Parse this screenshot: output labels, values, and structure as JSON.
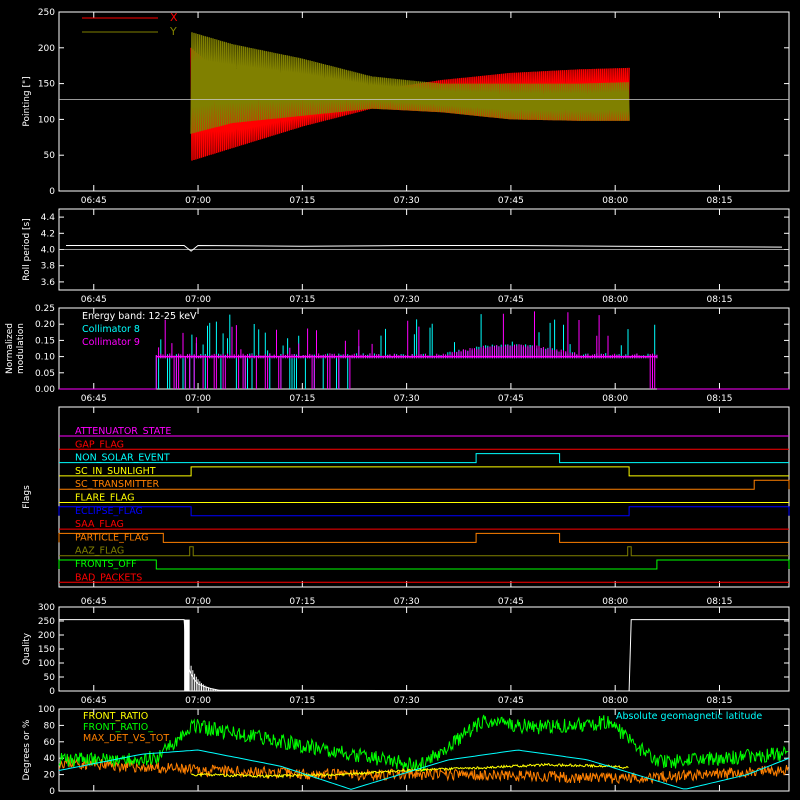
{
  "colors": {
    "background": "#000000",
    "axis": "#ffffff",
    "red": "#ff0000",
    "olive": "#808000",
    "cyan": "#00ffff",
    "magenta": "#ff00ff",
    "green": "#00ff00",
    "yellow": "#ffff00",
    "orange": "#ff8000",
    "blue": "#0000ff"
  },
  "time_ticks": [
    "06:45",
    "07:00",
    "07:15",
    "07:30",
    "07:45",
    "08:00",
    "08:15"
  ],
  "chart_data": [
    {
      "id": "pointing",
      "type": "line",
      "ylabel": "Pointing [\"]",
      "ylim": [
        0,
        250
      ],
      "yticks": [
        0,
        50,
        100,
        150,
        200,
        250
      ],
      "xlim": [
        "06:40",
        "08:25"
      ],
      "legend": [
        {
          "name": "X",
          "color": "#ff0000"
        },
        {
          "name": "Y",
          "color": "#808000"
        }
      ],
      "reference_line": 128,
      "series": [
        {
          "name": "X",
          "color": "#ff0000",
          "x": [
            "06:59",
            "07:05",
            "07:15",
            "07:25",
            "07:35",
            "07:45",
            "07:55",
            "08:02"
          ],
          "y_min": [
            42,
            60,
            90,
            115,
            110,
            100,
            98,
            98
          ],
          "y_max": [
            200,
            150,
            140,
            140,
            155,
            165,
            170,
            172
          ]
        },
        {
          "name": "Y",
          "color": "#808000",
          "x": [
            "06:59",
            "07:05",
            "07:15",
            "07:25",
            "07:35",
            "07:45",
            "07:55",
            "08:02"
          ],
          "y_min": [
            80,
            95,
            105,
            115,
            110,
            100,
            98,
            98
          ],
          "y_max": [
            222,
            205,
            185,
            160,
            150,
            150,
            150,
            152
          ]
        }
      ]
    },
    {
      "id": "roll",
      "type": "line",
      "ylabel": "Roll period [s]",
      "ylim": [
        3.5,
        4.5
      ],
      "yticks": [
        "3.6",
        "3.8",
        "4.0",
        "4.2",
        "4.4"
      ],
      "xlim": [
        "06:40",
        "08:25"
      ],
      "reference_line": 4.0,
      "series": [
        {
          "name": "Roll period",
          "color": "#ffffff",
          "x": [
            "06:41",
            "06:58",
            "06:59",
            "07:00",
            "07:15",
            "07:30",
            "07:45",
            "08:00",
            "08:24"
          ],
          "y": [
            4.05,
            4.05,
            3.98,
            4.05,
            4.04,
            4.05,
            4.05,
            4.04,
            4.03
          ]
        }
      ]
    },
    {
      "id": "modulation",
      "type": "line",
      "ylabel": "Normalized modulation",
      "ylim": [
        0,
        0.25
      ],
      "yticks": [
        "0.00",
        "0.05",
        "0.10",
        "0.15",
        "0.20",
        "0.25"
      ],
      "xlim": [
        "06:40",
        "08:25"
      ],
      "annotation": "Energy band: 12-25 keV",
      "legend": [
        {
          "name": "Collimator 8",
          "color": "#00ffff"
        },
        {
          "name": "Collimator 9",
          "color": "#ff00ff"
        }
      ],
      "active_range": [
        "06:54",
        "08:06"
      ],
      "baseline": 0.1,
      "series": [
        {
          "name": "Collimator 8",
          "color": "#00ffff"
        },
        {
          "name": "Collimator 9",
          "color": "#ff00ff"
        }
      ]
    },
    {
      "id": "flags",
      "type": "line",
      "ylabel": "Flags",
      "xlim": [
        "06:40",
        "08:25"
      ],
      "series": [
        {
          "name": "ATTENUATOR_STATE",
          "color": "#ff00ff",
          "high": []
        },
        {
          "name": "GAP_FLAG",
          "color": "#ff0000",
          "high": []
        },
        {
          "name": "NON_SOLAR_EVENT",
          "color": "#00ffff",
          "high": [
            [
              "07:40",
              "07:52"
            ]
          ]
        },
        {
          "name": "SC_IN_SUNLIGHT",
          "color": "#ffff00",
          "high": [
            [
              "06:59",
              "08:02"
            ]
          ]
        },
        {
          "name": "SC_TRANSMITTER",
          "color": "#ff8000",
          "high": [
            [
              "08:20",
              "08:25"
            ]
          ]
        },
        {
          "name": "FLARE_FLAG",
          "color": "#ffff00",
          "high": []
        },
        {
          "name": "ECLIPSE_FLAG",
          "color": "#0000ff",
          "high": [
            [
              "06:40",
              "06:59"
            ],
            [
              "08:02",
              "08:25"
            ]
          ]
        },
        {
          "name": "SAA_FLAG",
          "color": "#ff0000",
          "high": []
        },
        {
          "name": "PARTICLE_FLAG",
          "color": "#ff8000",
          "high": [
            [
              "06:40",
              "06:55"
            ],
            [
              "07:40",
              "07:52"
            ]
          ]
        },
        {
          "name": "AAZ_FLAG",
          "color": "#808000",
          "high": [
            [
              "06:58.8",
              "06:59.3"
            ],
            [
              "08:01.8",
              "08:02.3"
            ]
          ]
        },
        {
          "name": "FRONTS_OFF",
          "color": "#00ff00",
          "high": [
            [
              "06:40",
              "06:54"
            ],
            [
              "08:06",
              "08:25"
            ]
          ]
        },
        {
          "name": "BAD_PACKETS",
          "color": "#ff0000",
          "high": []
        }
      ]
    },
    {
      "id": "quality",
      "type": "bar",
      "ylabel": "Quality",
      "ylim": [
        0,
        300
      ],
      "yticks": [
        0,
        50,
        100,
        150,
        200,
        250,
        300
      ],
      "xlim": [
        "06:40",
        "08:25"
      ],
      "series": [
        {
          "name": "Quality",
          "color": "#ffffff",
          "x": [
            "06:40",
            "06:58",
            "06:58.5",
            "06:59",
            "06:59.5",
            "07:00",
            "07:01",
            "07:02",
            "07:03",
            "08:02",
            "08:02.3",
            "08:25"
          ],
          "y": [
            255,
            255,
            90,
            60,
            40,
            25,
            15,
            8,
            3,
            0,
            255,
            255
          ]
        }
      ]
    },
    {
      "id": "latitude",
      "type": "line",
      "ylabel": "Degrees or %",
      "ylim": [
        0,
        100
      ],
      "yticks": [
        0,
        20,
        40,
        60,
        80,
        100
      ],
      "xlim": [
        "06:40",
        "08:25"
      ],
      "annotation": "Absolute geomagnetic latitude",
      "legend": [
        {
          "name": "FRONT_RATIO",
          "color": "#ffff00"
        },
        {
          "name": "FRONT_RATIO_",
          "color": "#00ff00"
        },
        {
          "name": "MAX_DET_VS_TOT",
          "color": "#ff8000"
        }
      ],
      "series": [
        {
          "name": "Absolute geomagnetic latitude",
          "color": "#00ffff",
          "x": [
            "06:40",
            "06:52",
            "07:00",
            "07:12",
            "07:22",
            "07:36",
            "07:46",
            "07:56",
            "08:10",
            "08:19",
            "08:25"
          ],
          "y": [
            25,
            45,
            50,
            30,
            2,
            38,
            50,
            38,
            2,
            20,
            40
          ]
        },
        {
          "name": "FRONT_RATIO",
          "color": "#ffff00",
          "x": [
            "06:59",
            "07:10",
            "07:20",
            "07:30",
            "07:40",
            "07:50",
            "08:00",
            "08:02"
          ],
          "y": [
            20,
            18,
            20,
            25,
            28,
            32,
            30,
            28
          ]
        },
        {
          "name": "FRONT_RATIO_",
          "color": "#00ff00",
          "x": [
            "06:40",
            "06:54",
            "06:59",
            "07:32",
            "07:41",
            "07:48",
            "07:56",
            "07:59",
            "08:06",
            "08:25"
          ],
          "y": [
            38,
            40,
            80,
            30,
            85,
            78,
            80,
            85,
            35,
            45
          ]
        },
        {
          "name": "MAX_DET_VS_TOT",
          "color": "#ff8000",
          "x": [
            "06:40",
            "07:00",
            "07:20",
            "07:40",
            "08:00",
            "08:25"
          ],
          "y": [
            35,
            25,
            20,
            20,
            15,
            25
          ]
        }
      ]
    }
  ]
}
